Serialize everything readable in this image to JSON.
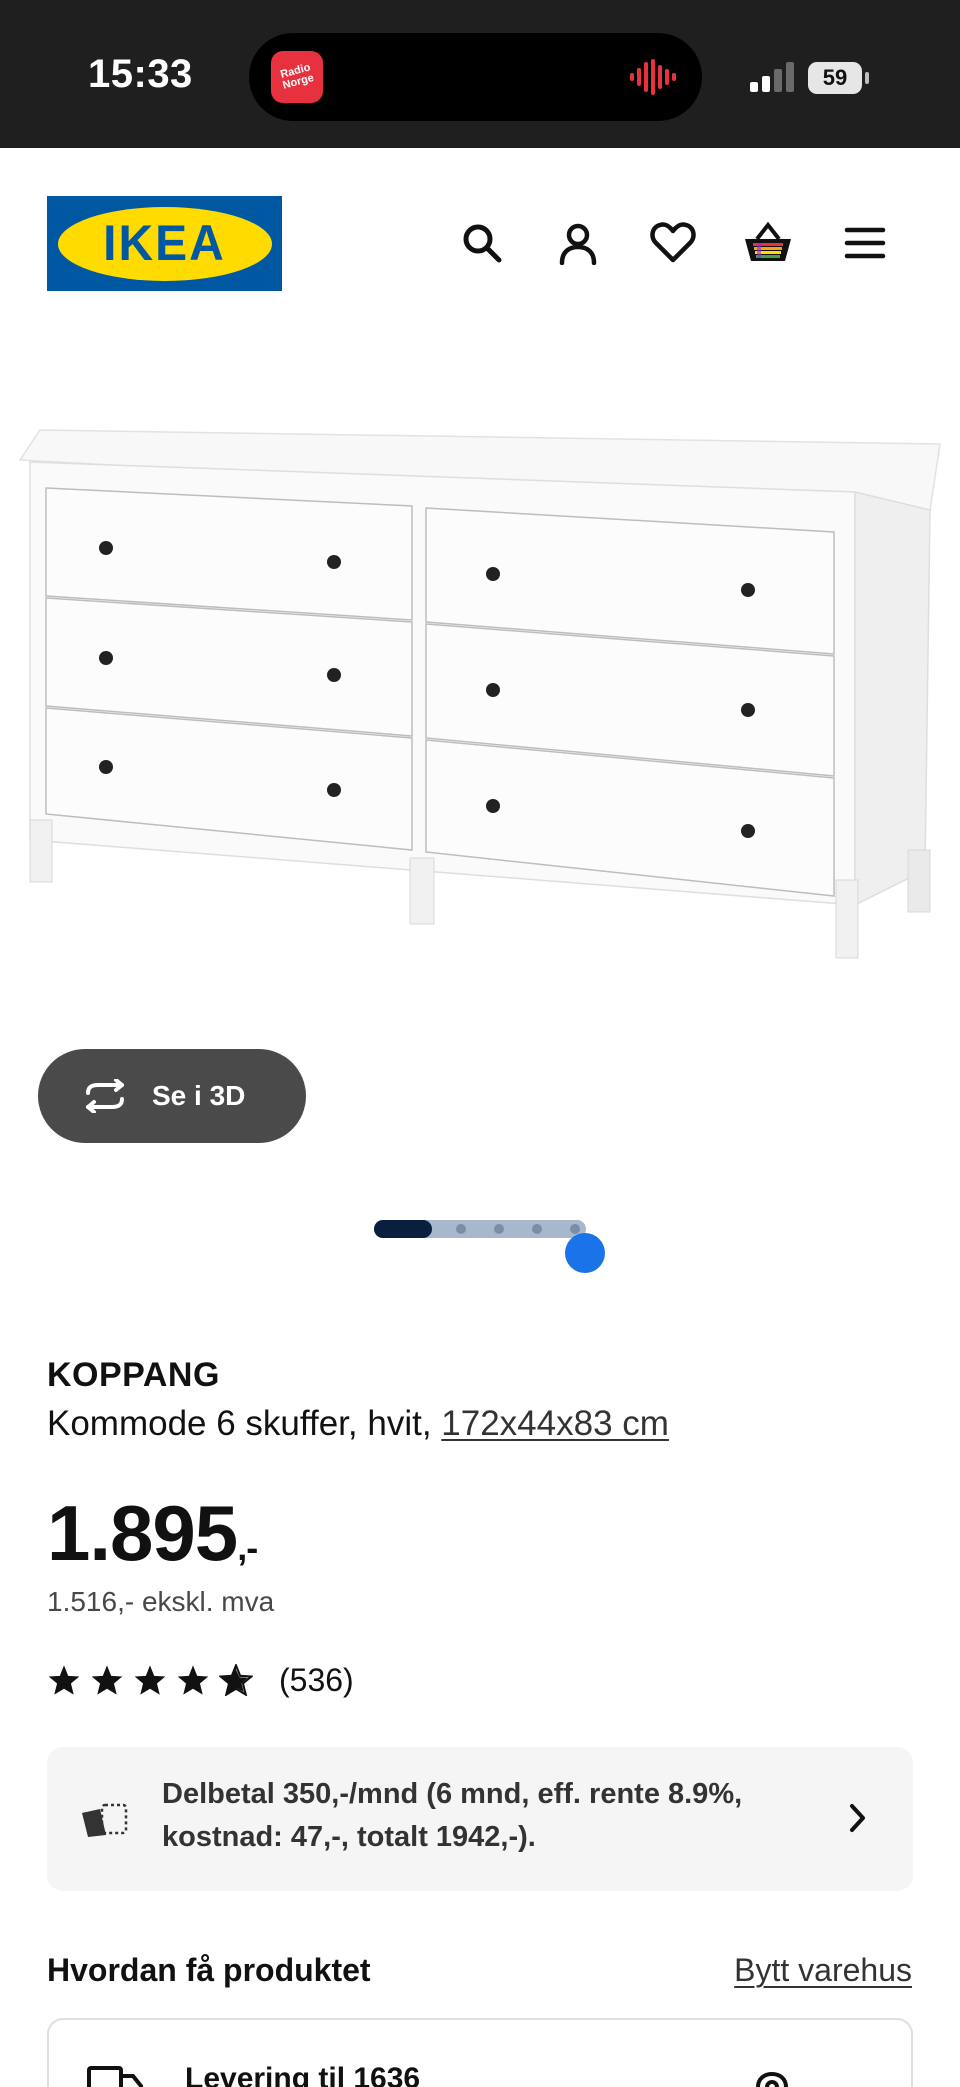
{
  "status_bar": {
    "time": "15:33",
    "app_badge": "Radio Norge",
    "battery": "59"
  },
  "header": {
    "logo_text": "IKEA",
    "icons": [
      "search-icon",
      "account-icon",
      "heart-icon",
      "basket-icon",
      "menu-icon"
    ]
  },
  "gallery": {
    "view_3d_label": "Se i 3D",
    "image_count": 5,
    "active_index": 0
  },
  "product": {
    "name": "KOPPANG",
    "description": "Kommode 6 skuffer, hvit,",
    "dimensions": "172x44x83 cm",
    "price": "1.895",
    "price_suffix": ",-",
    "price_ex_vat": "1.516,- ekskl. mva",
    "rating_value": 4.5,
    "rating_count": "(536)"
  },
  "installment": {
    "text": "Delbetal 350,-/mnd (6 mnd, eff. rente 8.9%, kostnad: 47,-, totalt 1942,-)."
  },
  "delivery": {
    "section_title": "Hvordan få produktet",
    "change_store_label": "Bytt varehus",
    "delivery_label": "Levering til 1636"
  },
  "colors": {
    "ikea_blue": "#0058a3",
    "ikea_yellow": "#ffdb00",
    "status_bar_bg": "#1f1f1f",
    "button_3d_bg": "#4a4a4a",
    "installment_bg": "#f5f5f5"
  }
}
